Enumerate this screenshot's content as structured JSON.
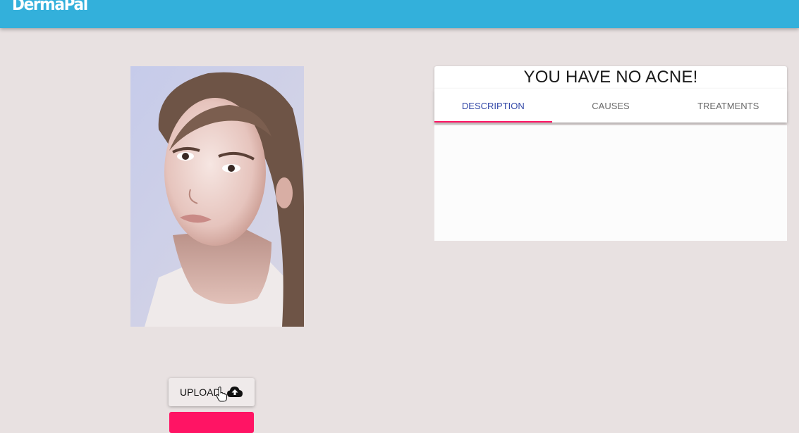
{
  "app": {
    "title": "DermaPal"
  },
  "upload": {
    "label": "UPLOAD",
    "icon": "cloud-upload-icon"
  },
  "result": {
    "title": "YOU HAVE NO ACNE!"
  },
  "tabs": [
    {
      "label": "DESCRIPTION",
      "active": true
    },
    {
      "label": "CAUSES",
      "active": false
    },
    {
      "label": "TREATMENTS",
      "active": false
    }
  ],
  "colors": {
    "appbar": "#33b0db",
    "background": "#e8e1e1",
    "accent": "#ff1464",
    "active_tab_text": "#3449a8"
  }
}
